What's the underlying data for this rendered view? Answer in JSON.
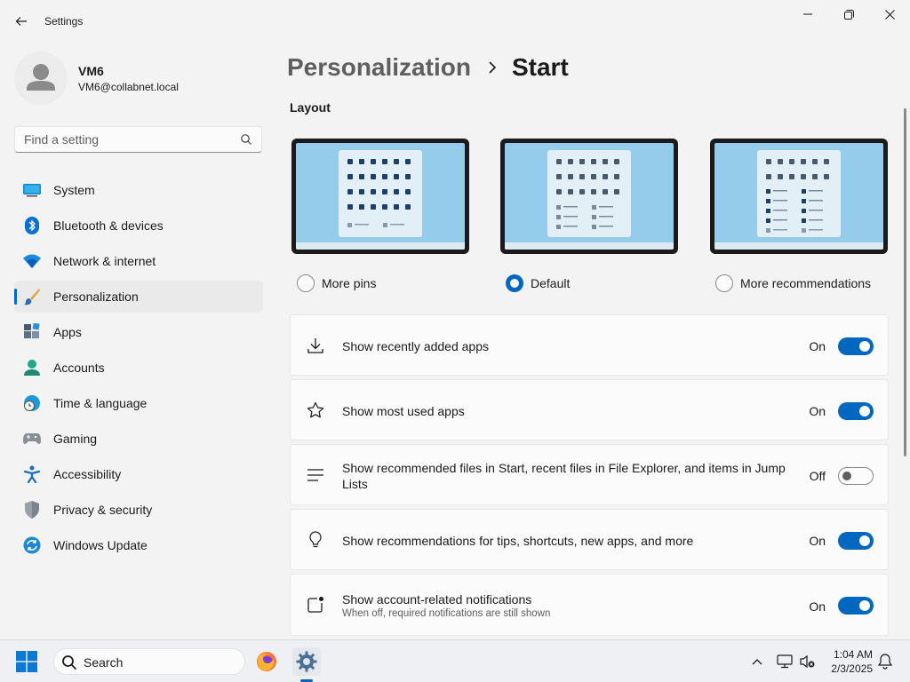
{
  "window": {
    "title": "Settings"
  },
  "user": {
    "name": "VM6",
    "email": "VM6@collabnet.local"
  },
  "search": {
    "placeholder": "Find a setting"
  },
  "nav": {
    "items": [
      {
        "label": "System",
        "icon": "system-icon"
      },
      {
        "label": "Bluetooth & devices",
        "icon": "bluetooth-icon"
      },
      {
        "label": "Network & internet",
        "icon": "wifi-icon"
      },
      {
        "label": "Personalization",
        "icon": "brush-icon",
        "active": true
      },
      {
        "label": "Apps",
        "icon": "apps-icon"
      },
      {
        "label": "Accounts",
        "icon": "accounts-icon"
      },
      {
        "label": "Time & language",
        "icon": "globe-clock-icon"
      },
      {
        "label": "Gaming",
        "icon": "gamepad-icon"
      },
      {
        "label": "Accessibility",
        "icon": "accessibility-icon"
      },
      {
        "label": "Privacy & security",
        "icon": "shield-icon"
      },
      {
        "label": "Windows Update",
        "icon": "update-icon"
      }
    ]
  },
  "breadcrumb": {
    "parent": "Personalization",
    "current": "Start"
  },
  "layout": {
    "label": "Layout",
    "options": [
      {
        "label": "More pins",
        "selected": false
      },
      {
        "label": "Default",
        "selected": true
      },
      {
        "label": "More recommendations",
        "selected": false
      }
    ]
  },
  "settings": [
    {
      "title": "Show recently added apps",
      "state": "On",
      "on": true,
      "icon": "download-icon"
    },
    {
      "title": "Show most used apps",
      "state": "On",
      "on": true,
      "icon": "star-icon"
    },
    {
      "title": "Show recommended files in Start, recent files in File Explorer, and items in Jump Lists",
      "state": "Off",
      "on": false,
      "icon": "list-icon"
    },
    {
      "title": "Show recommendations for tips, shortcuts, new apps, and more",
      "state": "On",
      "on": true,
      "icon": "lightbulb-icon"
    },
    {
      "title": "Show account-related notifications",
      "subtitle": "When off, required notifications are still shown",
      "state": "On",
      "on": true,
      "icon": "notification-dot-icon"
    }
  ],
  "taskbar": {
    "search_label": "Search",
    "time": "1:04 AM",
    "date": "2/3/2025"
  },
  "colors": {
    "accent": "#0067c0",
    "background": "#f3f3f3",
    "card": "#fbfbfb"
  }
}
